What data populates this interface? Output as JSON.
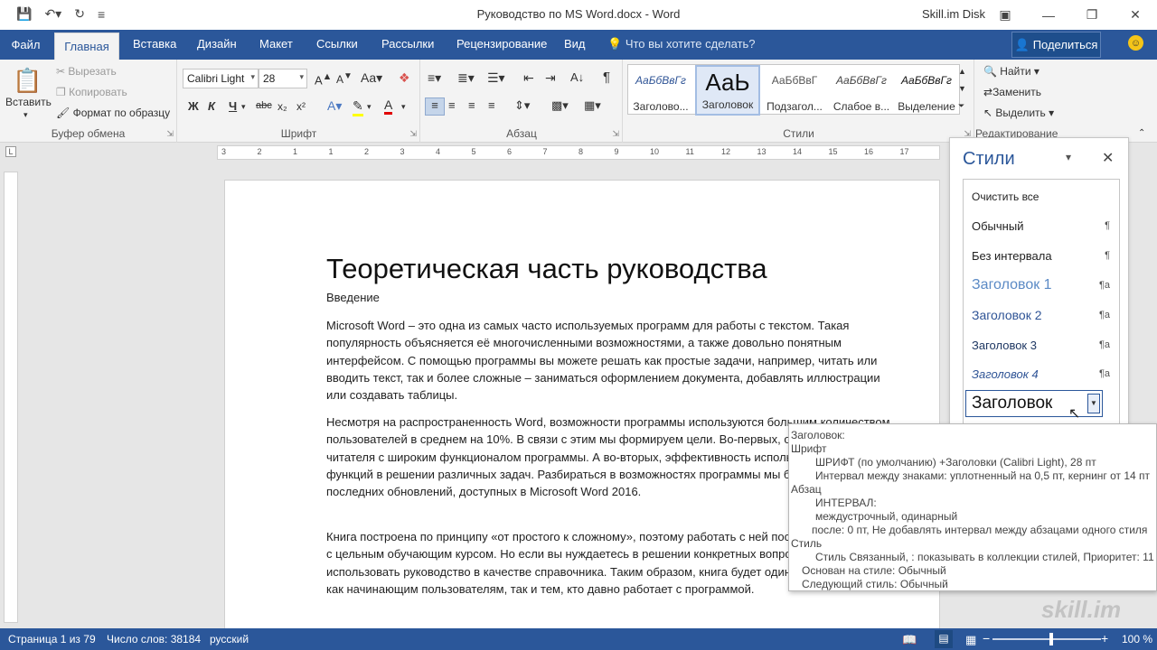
{
  "window": {
    "title": "Руководство по MS Word.docx  -  Word",
    "account": "Skill.im Disk"
  },
  "tabs": {
    "file": "Файл",
    "home": "Главная",
    "insert": "Вставка",
    "design": "Дизайн",
    "layout": "Макет",
    "references": "Ссылки",
    "mailings": "Рассылки",
    "review": "Рецензирование",
    "view": "Вид",
    "tell_me": "Что вы хотите сделать?",
    "share": "Поделиться"
  },
  "ribbon": {
    "clipboard": {
      "paste": "Вставить",
      "cut": "Вырезать",
      "copy": "Копировать",
      "format_painter": "Формат по образцу",
      "label": "Буфер обмена"
    },
    "font": {
      "name": "Calibri Light",
      "size": "28",
      "bold": "Ж",
      "italic": "К",
      "underline": "Ч",
      "strike": "abc",
      "sub": "x₂",
      "sup": "x²",
      "label": "Шрифт"
    },
    "paragraph": {
      "label": "Абзац"
    },
    "styles": {
      "label": "Стили",
      "tiles": [
        {
          "preview": "АаБбВвГг",
          "name": "Заголово..."
        },
        {
          "preview": "АаЬ",
          "name": "Заголовок"
        },
        {
          "preview": "АаБбВвГ",
          "name": "Подзагол..."
        },
        {
          "preview": "АаБбВвГг",
          "name": "Слабое в..."
        },
        {
          "preview": "АаБбВвГг",
          "name": "Выделение"
        }
      ]
    },
    "editing": {
      "find": "Найти",
      "replace": "Заменить",
      "select": "Выделить",
      "label": "Редактирование"
    }
  },
  "ruler": {
    "marks": [
      "3",
      "2",
      "1",
      "1",
      "2",
      "3",
      "4",
      "5",
      "6",
      "7",
      "8",
      "9",
      "10",
      "11",
      "12",
      "13",
      "14",
      "15",
      "16",
      "17"
    ]
  },
  "document": {
    "title": "Теоретическая часть руководства",
    "subtitle": "Введение",
    "paragraphs": [
      "Microsoft Word – это одна из самых часто используемых программ для работы с текстом. Такая популярность объясняется её многочисленными возможностями, а также довольно понятным интерфейсом. С помощью программы вы можете решать как простые задачи, например, читать или вводить текст, так и более сложные – заниматься оформлением документа, добавлять иллюстрации или создавать таблицы.",
      "Несмотря на распространенность Word, возможности программы используются большим количеством пользователей в среднем на 10%. В связи с этим мы формируем цели. Во-первых, ознакомить читателя с широким функционалом программы. А во-вторых, эффективность использования этих функций в решении различных задач. Разбираться в возможностях программы мы будем, с учетом последних обновлений, доступных в Microsoft Word 2016.",
      "Книга построена по принципу «от простого к сложному», поэтому работать с ней последовательно, как с цельным обучающим курсом. Но если вы нуждаетесь в решении конкретных вопросов, то можете использовать руководство в качестве справочника. Таким образом, книга будет одинаково полезной как начинающим пользователям, так и тем, кто давно работает с программой."
    ]
  },
  "styles_pane": {
    "title": "Стили",
    "items": [
      {
        "name": "Очистить все",
        "mark": ""
      },
      {
        "name": "Обычный",
        "mark": "¶"
      },
      {
        "name": "Без интервала",
        "mark": "¶"
      },
      {
        "name": "Заголовок 1",
        "mark": "¶a"
      },
      {
        "name": "Заголовок 2",
        "mark": "¶a"
      },
      {
        "name": "Заголовок 3",
        "mark": "¶a"
      },
      {
        "name": "Заголовок 4",
        "mark": "¶a"
      }
    ],
    "selected": "Заголовок"
  },
  "tooltip": {
    "heading": "Заголовок:",
    "font_section": "Шрифт",
    "font_line1": "ШРИФТ (по умолчанию) +Заголовки (Calibri Light), 28 пт",
    "font_line2": "Интервал между знаками:  уплотненный на  0,5 пт, кернинг от 14 пт",
    "para_section": "Абзац",
    "interval": "ИНТЕРВАЛ:",
    "line_spacing": "междустрочный,  одинарный",
    "after": "после: 0 пт, Не добавлять интервал между абзацами одного стиля",
    "style_section": "Стиль",
    "style_line": "Стиль Связанный, : показывать в коллекции стилей, Приоритет: 11",
    "based_on": "Основан на стиле: Обычный",
    "next_style": "Следующий стиль: Обычный"
  },
  "status": {
    "page": "Страница 1 из 79",
    "words": "Число слов: 38184",
    "language": "русский",
    "zoom": "100 %"
  },
  "watermark": "skill.im",
  "colors": {
    "accent": "#2b579a",
    "ribbon_bg": "#f3f3f3"
  }
}
